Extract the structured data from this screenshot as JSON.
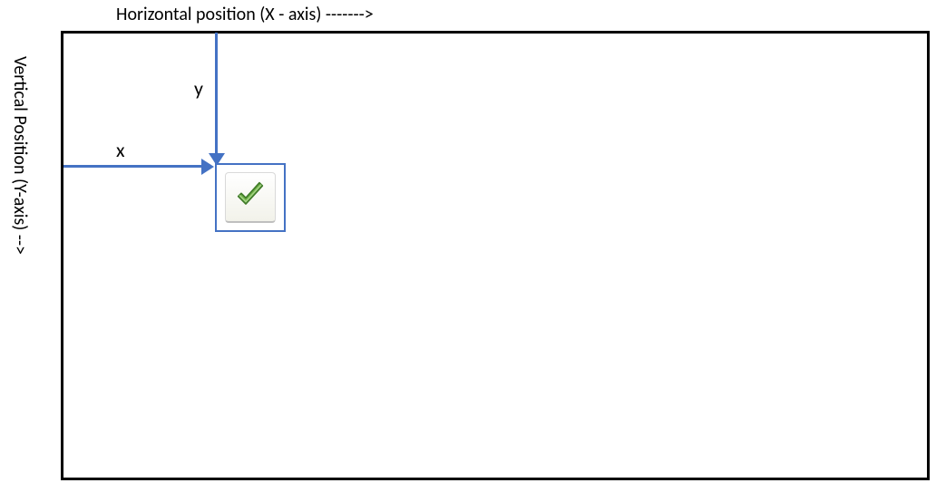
{
  "labels": {
    "x_axis": "Horizontal position (X - axis) ------->",
    "y_axis": "Vertical Position (Y-axis)  -->",
    "x_marker": "x",
    "y_marker": "y"
  },
  "icon": {
    "name": "checkmark-icon"
  },
  "colors": {
    "arrow": "#4472C4",
    "box_border": "#000000",
    "check_fill": "#6FAF46",
    "check_stroke": "#3F7A28"
  }
}
